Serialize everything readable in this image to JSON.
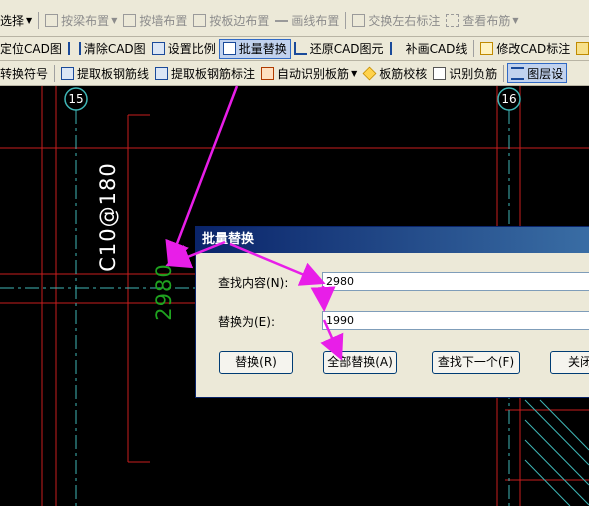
{
  "toolbar_row1": {
    "select_label": "选择",
    "items": [
      {
        "label": "按梁布置",
        "icon": "beam-icon"
      },
      {
        "label": "按墙布置",
        "icon": "wall-icon"
      },
      {
        "label": "按板边布置",
        "icon": "slab-edge-icon"
      },
      {
        "label": "画线布置",
        "icon": "line-icon"
      },
      {
        "label": "交换左右标注",
        "icon": "swap-icon"
      },
      {
        "label": "查看布筋",
        "icon": "view-rebar-icon"
      }
    ]
  },
  "toolbar_row2": {
    "items": [
      {
        "label": "定位CAD图"
      },
      {
        "label": "清除CAD图",
        "icon": "clear-cad-icon"
      },
      {
        "label": "设置比例",
        "icon": "scale-icon"
      },
      {
        "label": "批量替换",
        "icon": "batch-replace-icon"
      },
      {
        "label": "还原CAD图元",
        "icon": "restore-icon"
      },
      {
        "label": "补画CAD线",
        "icon": "draw-cad-line-icon"
      },
      {
        "label": "修改CAD标注",
        "icon": "edit-annotation-icon"
      }
    ]
  },
  "toolbar_row3": {
    "items": [
      {
        "label": "转换符号"
      },
      {
        "label": "提取板钢筋线",
        "icon": "extract-line-icon"
      },
      {
        "label": "提取板钢筋标注",
        "icon": "extract-annotation-icon"
      },
      {
        "label": "自动识别板筋",
        "icon": "auto-recognize-icon"
      },
      {
        "label": "板筋校核",
        "icon": "check-icon"
      },
      {
        "label": "识别负筋",
        "icon": "negative-rebar-icon"
      },
      {
        "label": "图层设",
        "icon": "layer-icon"
      }
    ]
  },
  "canvas": {
    "axis_15": "15",
    "axis_16": "16",
    "rebar_label": "C10@180",
    "length_label": "2980"
  },
  "dialog": {
    "title": "批量替换",
    "find_label": "查找内容(N):",
    "find_value": "2980",
    "replace_label": "替换为(E):",
    "replace_value": "1990",
    "btn_replace": "替换(R)",
    "btn_replace_all": "全部替换(A)",
    "btn_find_next": "查找下一个(F)",
    "btn_close": "关闭"
  },
  "colors": {
    "canvas_bg": "#000000",
    "grid_red": "#c81e1e",
    "axis_cyan": "#3fb6b6",
    "annotation_white": "#ffffff",
    "annotation_green": "#1fa21f",
    "arrow_magenta": "#e81ee8"
  }
}
